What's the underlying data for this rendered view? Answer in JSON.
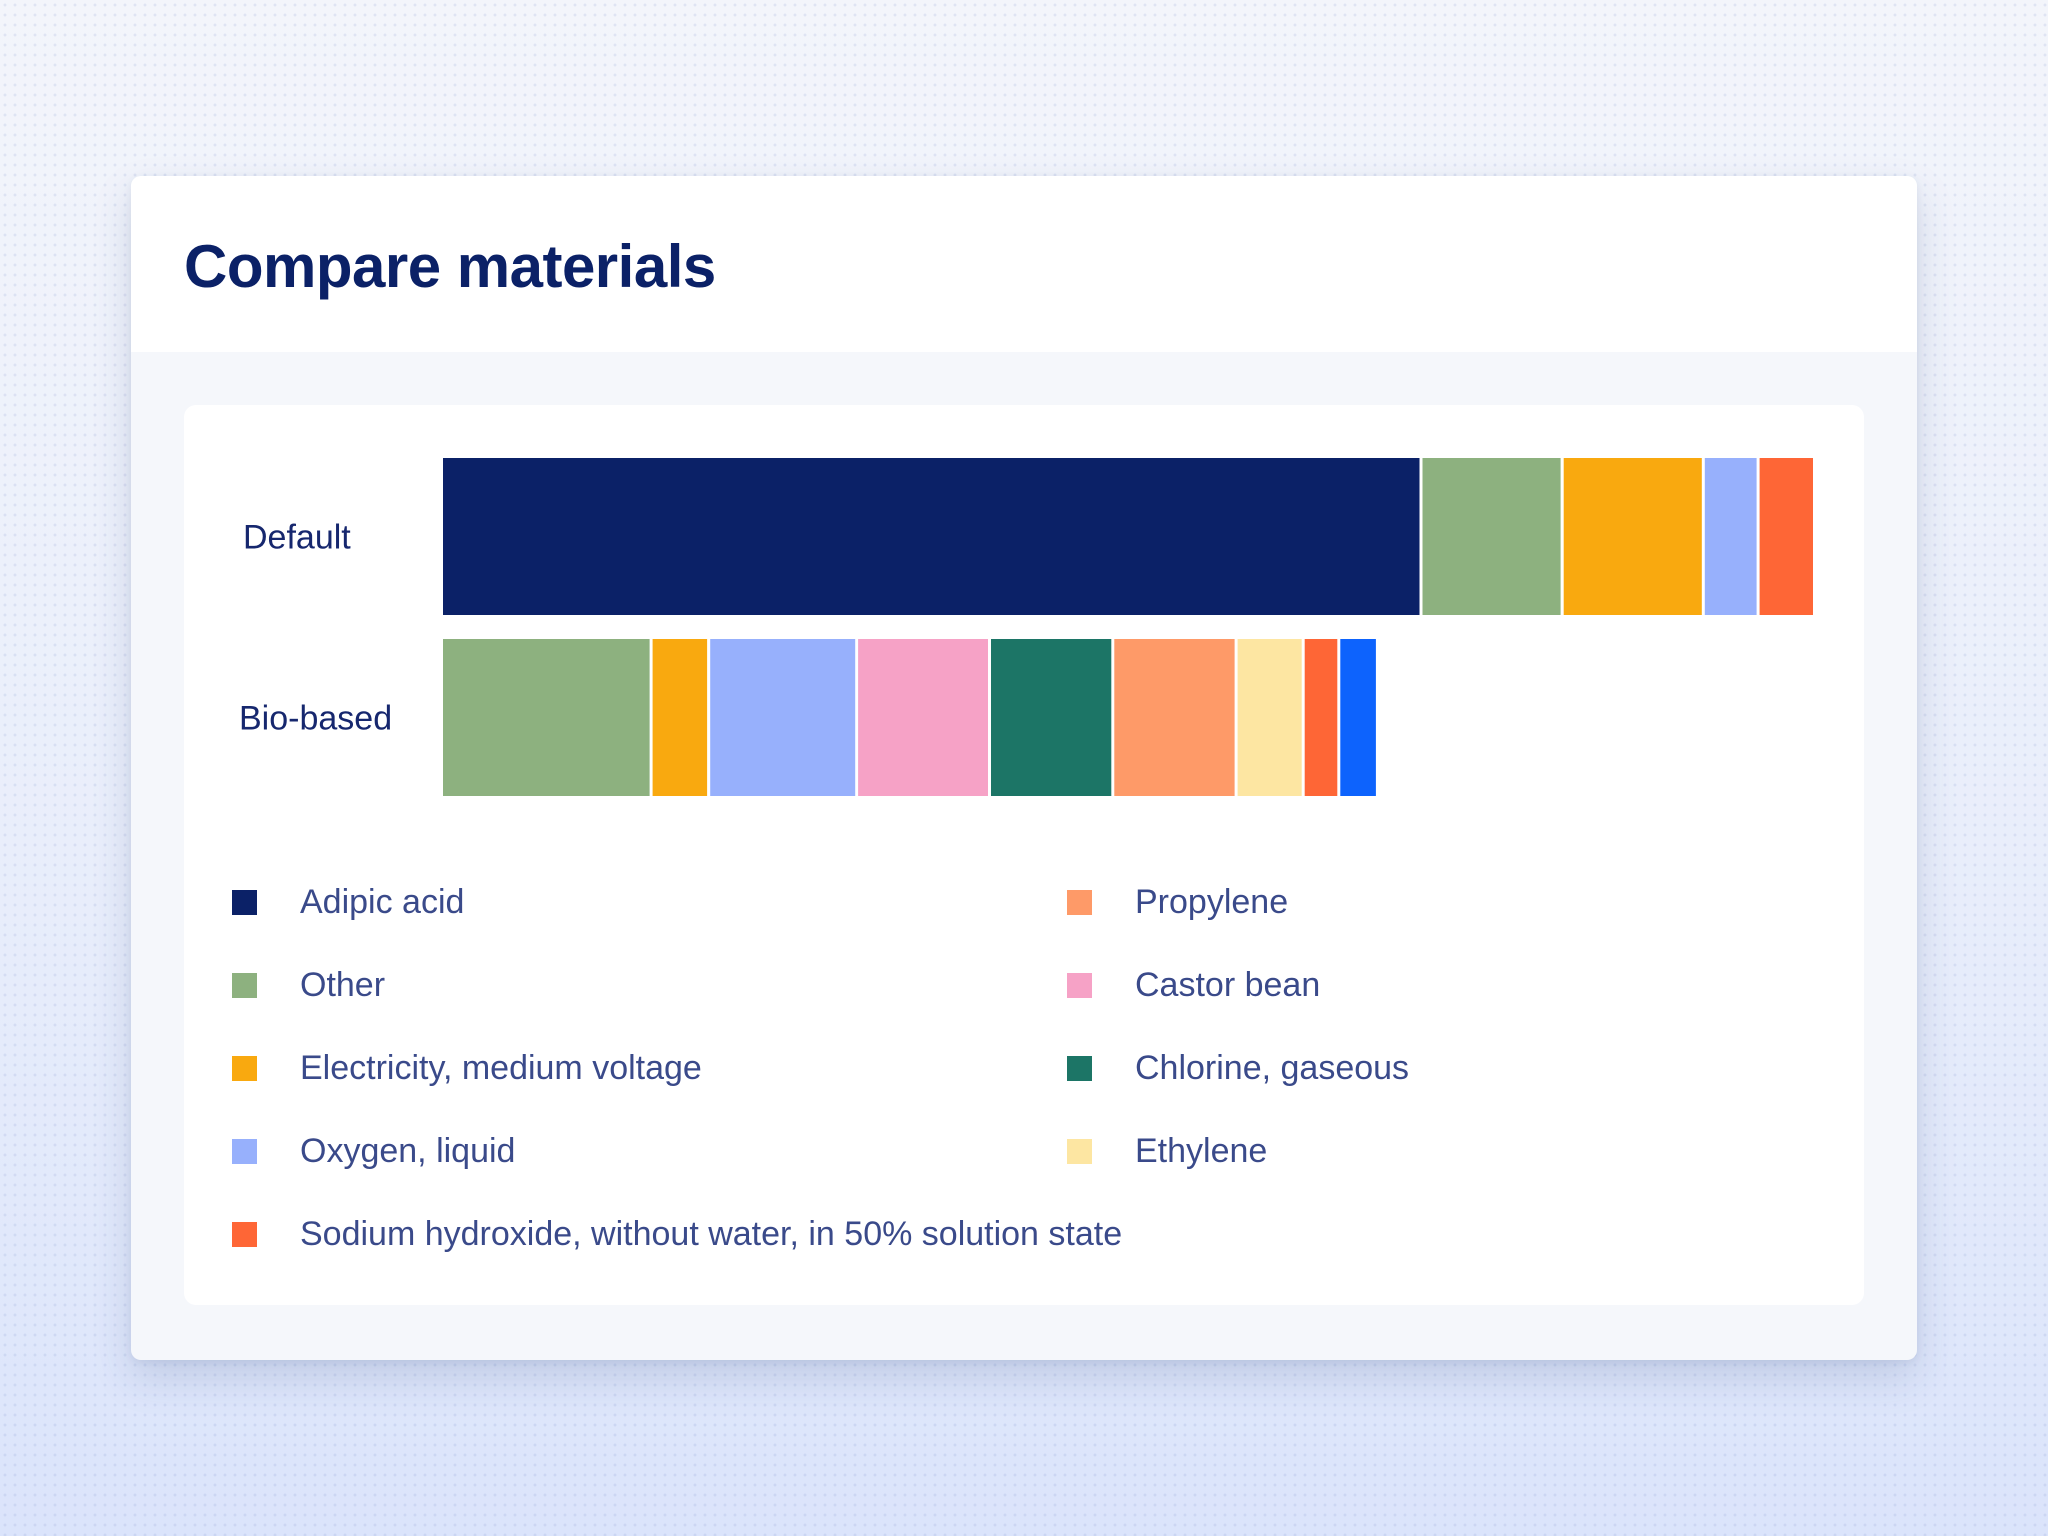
{
  "card": {
    "title": "Compare materials"
  },
  "colors": {
    "Adipic acid": "#0b2167",
    "Other": "#8db17f",
    "Electricity, medium voltage": "#f9a90f",
    "Oxygen, liquid": "#97b0fc",
    "Sodium hydroxide, without water, in 50% solution state": "#fe6636",
    "Propylene": "#fe9a68",
    "Castor bean": "#f6a2c6",
    "Chlorine, gaseous": "#1c7566",
    "Ethylene": "#fde6a2",
    "Unlabeled": "#0d63fd"
  },
  "chart_data": {
    "type": "bar",
    "orientation": "horizontal",
    "stacked": true,
    "categories": [
      "Default",
      "Bio-based"
    ],
    "stacks": [
      {
        "category": "Default",
        "segments": [
          {
            "name": "Adipic acid",
            "value": 71.5
          },
          {
            "name": "Other",
            "value": 10.3
          },
          {
            "name": "Electricity, medium voltage",
            "value": 10.3
          },
          {
            "name": "Oxygen, liquid",
            "value": 4.0
          },
          {
            "name": "Sodium hydroxide, without water, in 50% solution state",
            "value": 3.9
          }
        ]
      },
      {
        "category": "Bio-based",
        "segments": [
          {
            "name": "Other",
            "value": 15.3
          },
          {
            "name": "Electricity, medium voltage",
            "value": 4.2
          },
          {
            "name": "Oxygen, liquid",
            "value": 10.8
          },
          {
            "name": "Castor bean",
            "value": 9.7
          },
          {
            "name": "Chlorine, gaseous",
            "value": 9.0
          },
          {
            "name": "Propylene",
            "value": 9.0
          },
          {
            "name": "Ethylene",
            "value": 4.9
          },
          {
            "name": "Sodium hydroxide, without water, in 50% solution state",
            "value": 2.6
          },
          {
            "name": "Unlabeled",
            "value": 2.6
          }
        ]
      }
    ],
    "xlim": [
      0,
      100
    ],
    "grid": false,
    "legend_position": "bottom",
    "legend": [
      {
        "label": "Adipic acid"
      },
      {
        "label": "Other"
      },
      {
        "label": "Electricity, medium voltage"
      },
      {
        "label": "Oxygen, liquid"
      },
      {
        "label": "Sodium hydroxide, without water, in 50% solution state"
      },
      {
        "label": "Propylene"
      },
      {
        "label": "Castor bean"
      },
      {
        "label": "Chlorine, gaseous"
      },
      {
        "label": "Ethylene"
      }
    ]
  }
}
